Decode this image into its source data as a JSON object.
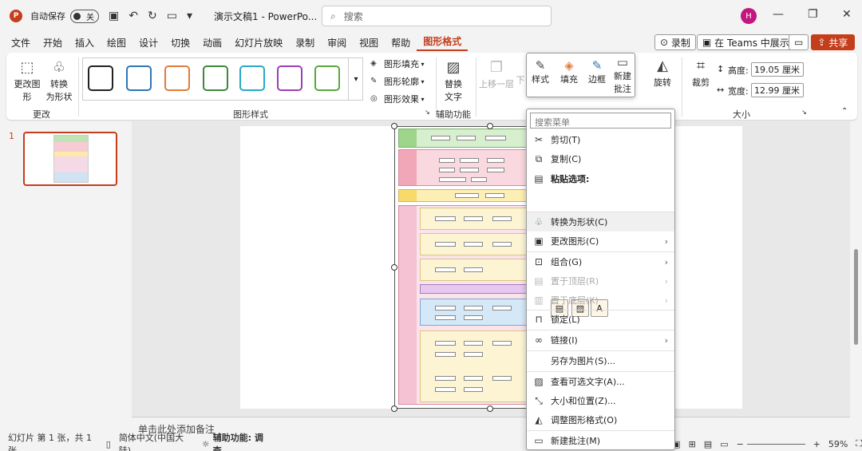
{
  "titlebar": {
    "autosave_label": "自动保存",
    "autosave_state": "关",
    "doc_title": "演示文稿1 - PowerPo...",
    "search_placeholder": "搜索",
    "avatar": "H"
  },
  "menubar": {
    "items": [
      "文件",
      "开始",
      "插入",
      "绘图",
      "设计",
      "切换",
      "动画",
      "幻灯片放映",
      "录制",
      "审阅",
      "视图",
      "帮助",
      "图形格式"
    ],
    "record": "录制",
    "teams": "在 Teams 中展示",
    "share": "共享"
  },
  "ribbon": {
    "change_shape": "更改图\n形",
    "convert_shape": "转换\n为形状",
    "group_change": "更改",
    "group_styles": "图形样式",
    "fill": "图形填充",
    "outline": "图形轮廓",
    "effects": "图形效果",
    "alt_text": "替换\n文字",
    "group_accessibility": "辅助功能",
    "bring_forward": "上移一层",
    "send_back": "下",
    "rotate": "旋转",
    "crop": "裁剪",
    "height_label": "高度:",
    "height_value": "19.05 厘米",
    "width_label": "宽度:",
    "width_value": "12.99 厘米",
    "group_size": "大小"
  },
  "style_colors": [
    "#222222",
    "#2e75b6",
    "#e07b39",
    "#3a8a3a",
    "#2aa7c9",
    "#9b3fb5",
    "#56a83a"
  ],
  "mini_toolbar": {
    "style": "样式",
    "fill": "填充",
    "border": "边框",
    "new_comment": "新建\n批注"
  },
  "context_menu": {
    "search_placeholder": "搜索菜单",
    "items": [
      {
        "label": "剪切(T)",
        "icon": "scissors-icon",
        "glyph": "✂",
        "enabled": true,
        "submenu": false
      },
      {
        "label": "复制(C)",
        "icon": "copy-icon",
        "glyph": "⧉",
        "enabled": true,
        "submenu": false
      },
      {
        "label": "粘贴选项:",
        "icon": "paste-icon",
        "glyph": "📋",
        "enabled": true,
        "submenu": false
      },
      {
        "label": "转换为形状(C)",
        "icon": "convert-shape-icon",
        "glyph": "◈",
        "enabled": true,
        "submenu": false
      },
      {
        "label": "更改图形(C)",
        "icon": "change-shape-icon",
        "glyph": "▣",
        "enabled": true,
        "submenu": true
      },
      {
        "label": "组合(G)",
        "icon": "group-icon",
        "glyph": "⊡",
        "enabled": true,
        "submenu": true
      },
      {
        "label": "置于顶层(R)",
        "icon": "bring-front-icon",
        "glyph": "▤",
        "enabled": false,
        "submenu": true
      },
      {
        "label": "置于底层(K)",
        "icon": "send-back-icon",
        "glyph": "▥",
        "enabled": false,
        "submenu": true
      },
      {
        "label": "锁定(L)",
        "icon": "lock-icon",
        "glyph": "🔒",
        "enabled": true,
        "submenu": false
      },
      {
        "label": "链接(I)",
        "icon": "link-icon",
        "glyph": "∞",
        "enabled": true,
        "submenu": true
      },
      {
        "label": "另存为图片(S)...",
        "icon": "none",
        "glyph": "",
        "enabled": true,
        "submenu": false
      },
      {
        "label": "查看可选文字(A)...",
        "icon": "alt-text-icon",
        "glyph": "▨",
        "enabled": true,
        "submenu": false
      },
      {
        "label": "大小和位置(Z)...",
        "icon": "size-position-icon",
        "glyph": "⤡",
        "enabled": true,
        "submenu": false
      },
      {
        "label": "调整图形格式(O)",
        "icon": "format-shape-icon",
        "glyph": "◭",
        "enabled": true,
        "submenu": false
      },
      {
        "label": "新建批注(M)",
        "icon": "comment-icon",
        "glyph": "▭",
        "enabled": true,
        "submenu": false
      }
    ]
  },
  "slides": {
    "number": "1"
  },
  "notes_placeholder": "单击此处添加备注",
  "status": {
    "slide_info": "幻灯片 第 1 张，共 1 张",
    "language": "简体中文(中国大陆)",
    "accessibility": "辅助功能: 调查",
    "zoom": "59%"
  }
}
